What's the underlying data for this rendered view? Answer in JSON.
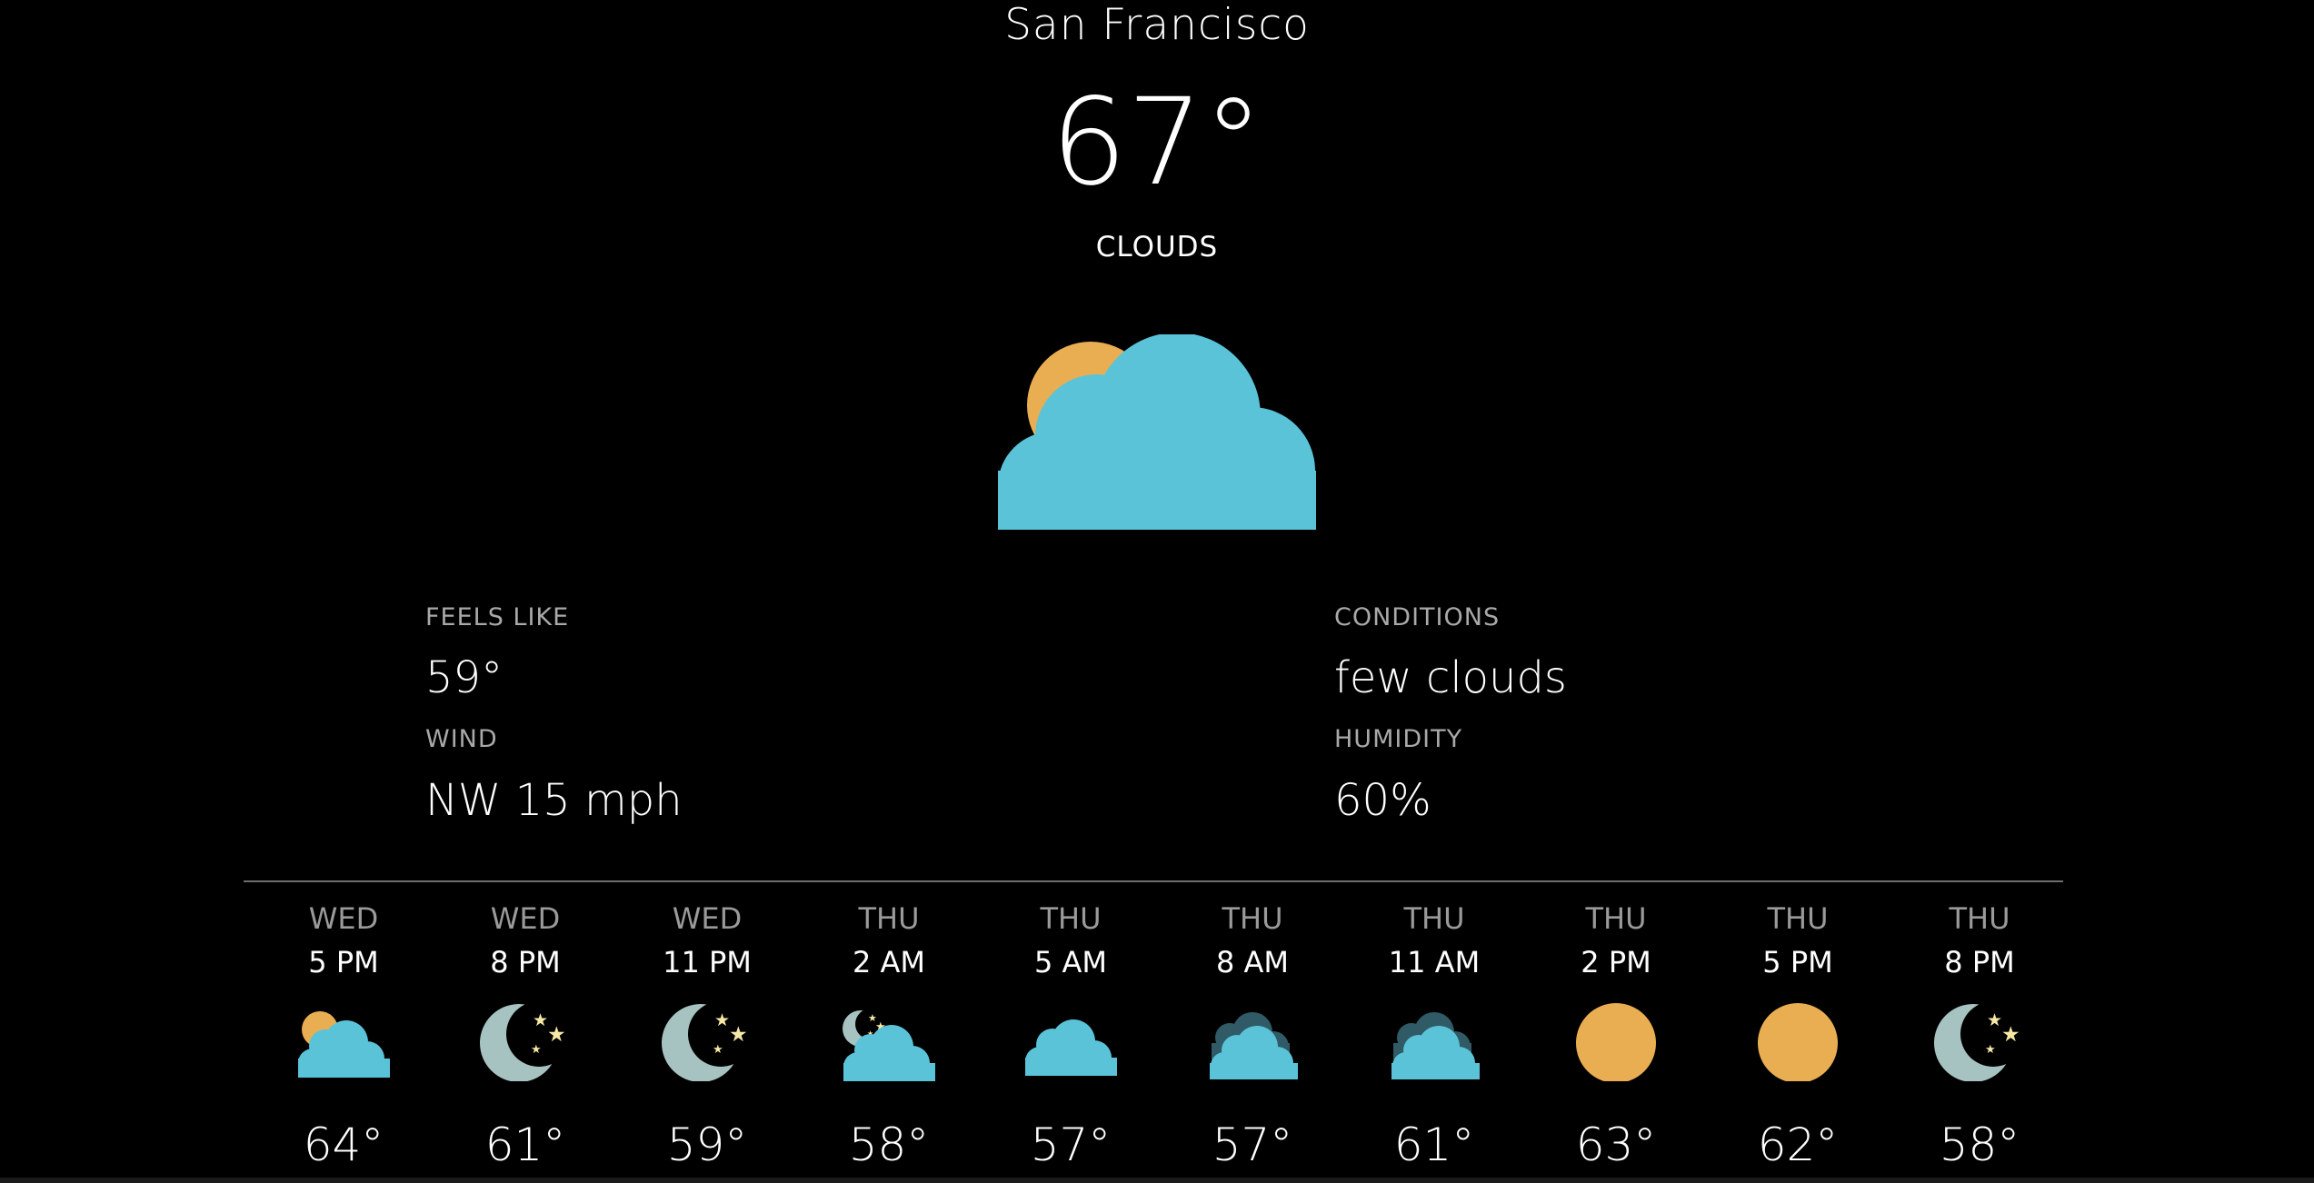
{
  "current": {
    "city": "San Francisco",
    "temperature": "67°",
    "summary": "CLOUDS",
    "icon": "partly-cloudy-day-icon"
  },
  "details": {
    "feels_like_label": "FEELS LIKE",
    "feels_like_value": "59°",
    "wind_label": "WIND",
    "wind_value": "NW 15 mph",
    "conditions_label": "CONDITIONS",
    "conditions_value": "few clouds",
    "humidity_label": "HUMIDITY",
    "humidity_value": "60%"
  },
  "forecast": [
    {
      "day": "WED",
      "time": "5 PM",
      "temp": "64°",
      "icon": "partly-cloudy-day-icon"
    },
    {
      "day": "WED",
      "time": "8 PM",
      "temp": "61°",
      "icon": "clear-night-icon"
    },
    {
      "day": "WED",
      "time": "11 PM",
      "temp": "59°",
      "icon": "clear-night-icon"
    },
    {
      "day": "THU",
      "time": "2 AM",
      "temp": "58°",
      "icon": "partly-cloudy-night-icon"
    },
    {
      "day": "THU",
      "time": "5 AM",
      "temp": "57°",
      "icon": "cloud-icon"
    },
    {
      "day": "THU",
      "time": "8 AM",
      "temp": "57°",
      "icon": "broken-clouds-icon"
    },
    {
      "day": "THU",
      "time": "11 AM",
      "temp": "61°",
      "icon": "broken-clouds-icon"
    },
    {
      "day": "THU",
      "time": "2 PM",
      "temp": "63°",
      "icon": "sun-icon"
    },
    {
      "day": "THU",
      "time": "5 PM",
      "temp": "62°",
      "icon": "sun-icon"
    },
    {
      "day": "THU",
      "time": "8 PM",
      "temp": "58°",
      "icon": "clear-night-icon"
    }
  ],
  "colors": {
    "background": "#000000",
    "sun": "#E9AE51",
    "cloud": "#5BC3D8",
    "dark_cloud": "#2F5A66",
    "moon": "#A7C3C1",
    "star": "#F6E8A6",
    "label": "#A9A9A9",
    "divider": "#6E6E6E"
  }
}
